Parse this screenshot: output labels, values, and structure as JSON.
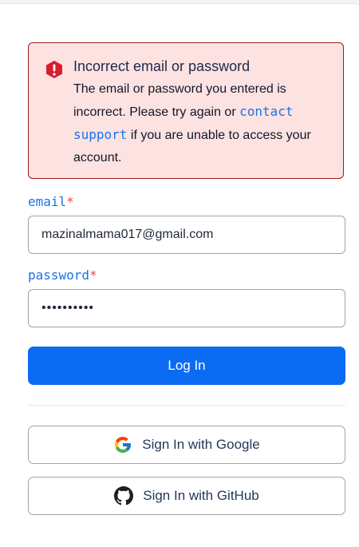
{
  "alert": {
    "title": "Incorrect email or password",
    "body_before": "The email or password you entered is incorrect. Please try again or ",
    "link": "contact support",
    "body_after": " if you are unable to access your account.",
    "icon": "alert-icon"
  },
  "form": {
    "email_label": "email",
    "email_value": "mazinalmama017@gmail.com",
    "password_label": "password",
    "password_value": "••••••••••",
    "required_marker": "*",
    "submit_label": "Log In"
  },
  "social": {
    "google_label": "Sign In with Google",
    "github_label": "Sign In with GitHub",
    "google_icon": "google-icon",
    "github_icon": "github-icon"
  },
  "colors": {
    "primary": "#0b6bf2",
    "alert_bg": "#fde2e2",
    "alert_border": "#9b1c1c",
    "error": "#d61f2c",
    "link": "#1a73e8"
  }
}
